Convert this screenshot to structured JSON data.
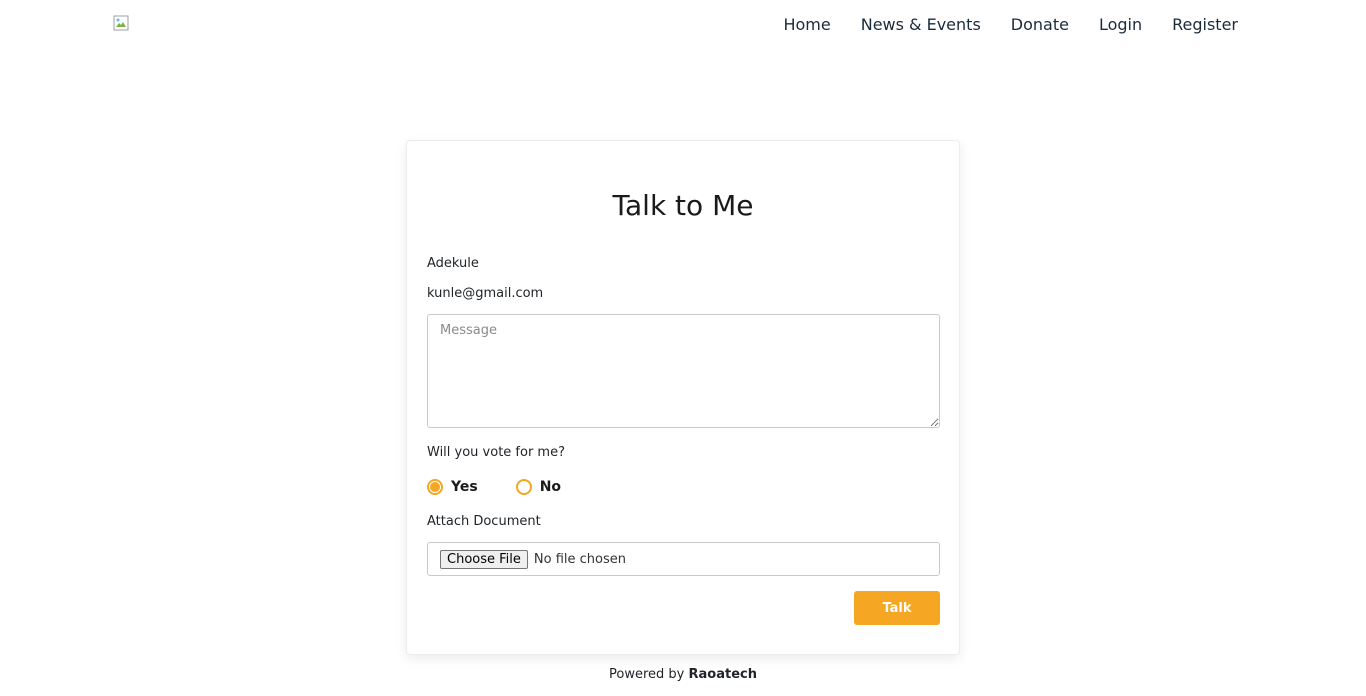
{
  "nav": {
    "logo_icon": "broken-image-icon",
    "links": [
      "Home",
      "News & Events",
      "Donate",
      "Login",
      "Register"
    ]
  },
  "form": {
    "title": "Talk to Me",
    "name_value": "Adekule",
    "email_value": "kunle@gmail.com",
    "message_placeholder": "Message",
    "question": "Will you vote for me?",
    "options": {
      "yes": "Yes",
      "no": "No",
      "selected": "yes"
    },
    "attach_label": "Attach Document",
    "file_button": "Choose File",
    "file_status": "No file chosen",
    "submit_label": "Talk"
  },
  "footer": {
    "prefix": "Powered by",
    "brand": "Raoatech"
  },
  "colors": {
    "accent": "#f5a623",
    "nav_text": "#1a2b3c"
  }
}
